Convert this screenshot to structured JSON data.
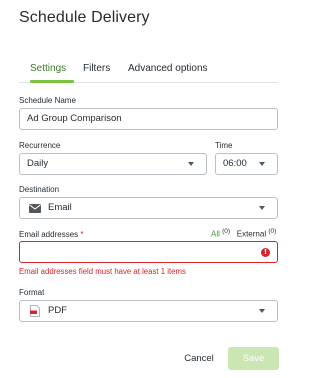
{
  "title": "Schedule Delivery",
  "tabs": [
    {
      "label": "Settings",
      "active": true
    },
    {
      "label": "Filters",
      "active": false
    },
    {
      "label": "Advanced options",
      "active": false
    }
  ],
  "schedule_name": {
    "label": "Schedule Name",
    "value": "Ad Group Comparison"
  },
  "recurrence": {
    "label": "Recurrence",
    "value": "Daily"
  },
  "time": {
    "label": "Time",
    "value": "06:00"
  },
  "destination": {
    "label": "Destination",
    "value": "Email",
    "icon": "email-icon"
  },
  "email": {
    "label": "Email addresses",
    "required_marker": "*",
    "all_label": "All",
    "all_count": "(0)",
    "external_label": "External",
    "external_count": "(0)",
    "value": "",
    "error": "Email addresses field must have at least 1 items",
    "error_icon": "!"
  },
  "format": {
    "label": "Format",
    "value": "PDF",
    "icon": "pdf-icon"
  },
  "actions": {
    "cancel": "Cancel",
    "save": "Save"
  },
  "colors": {
    "accent": "#7bc241",
    "error": "#d8232a",
    "save_disabled": "#c9e6b3"
  }
}
